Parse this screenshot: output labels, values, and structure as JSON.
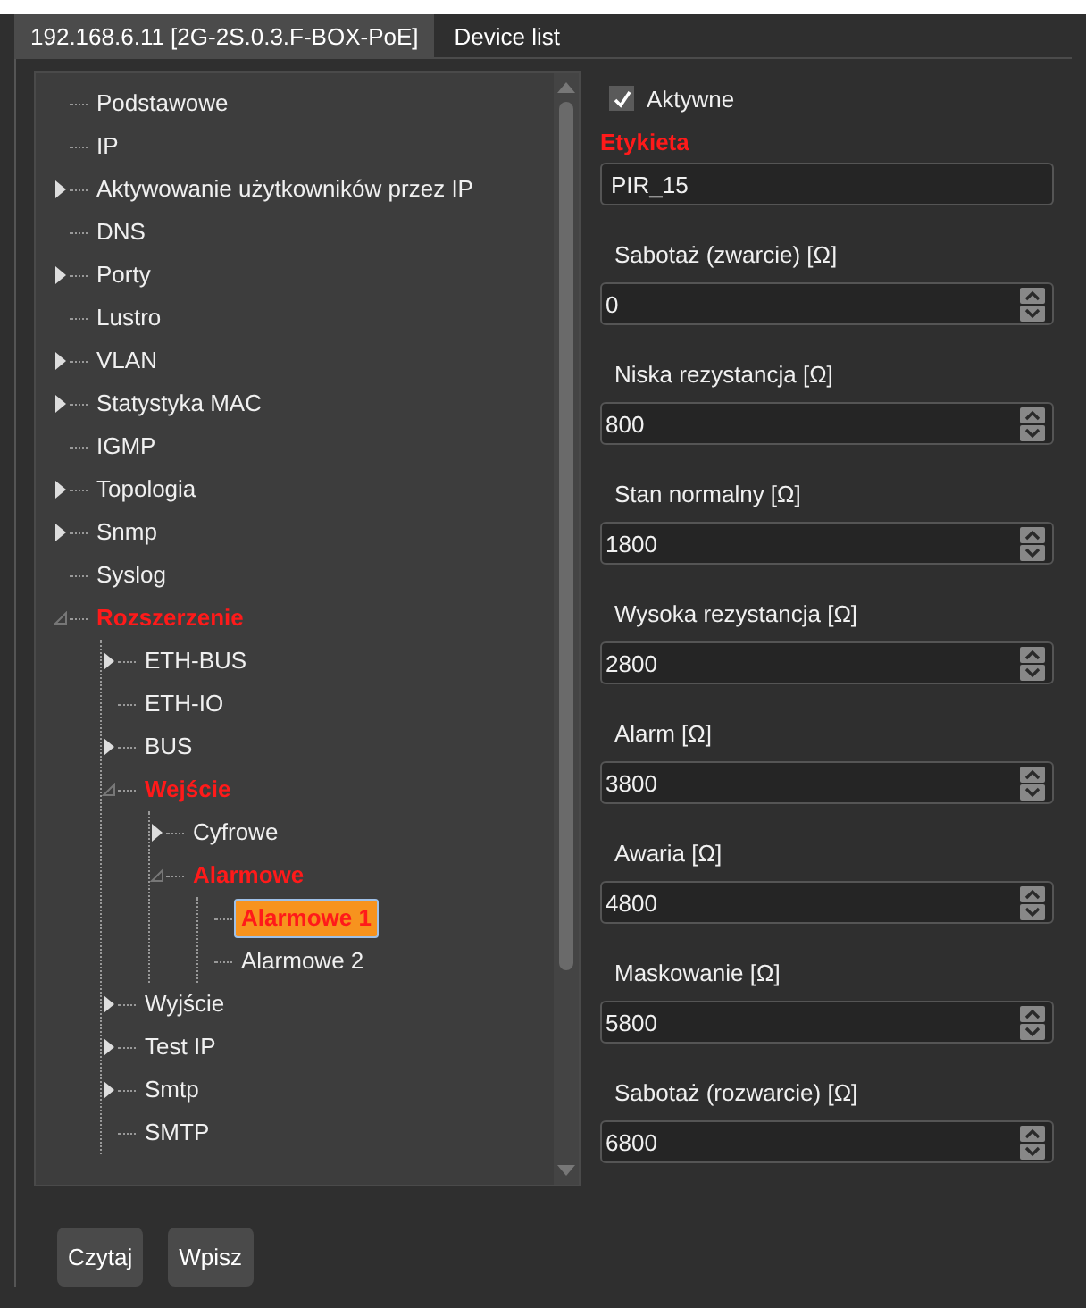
{
  "tabs": [
    {
      "label": "192.168.6.11 [2G-2S.0.3.F-BOX-PoE]",
      "selected": true
    },
    {
      "label": "Device list",
      "selected": false
    }
  ],
  "tree": [
    {
      "label": "Podstawowe",
      "kind": "leaf",
      "selected": false
    },
    {
      "label": "IP",
      "kind": "leaf",
      "selected": false
    },
    {
      "label": "Aktywowanie użytkowników przez IP",
      "kind": "folder",
      "expanded": false,
      "selected": false
    },
    {
      "label": "DNS",
      "kind": "leaf",
      "selected": false
    },
    {
      "label": "Porty",
      "kind": "folder",
      "expanded": false,
      "selected": false
    },
    {
      "label": "Lustro",
      "kind": "leaf",
      "selected": false
    },
    {
      "label": "VLAN",
      "kind": "folder",
      "expanded": false,
      "selected": false
    },
    {
      "label": "Statystyka MAC",
      "kind": "folder",
      "expanded": false,
      "selected": false
    },
    {
      "label": "IGMP",
      "kind": "leaf",
      "selected": false
    },
    {
      "label": "Topologia",
      "kind": "folder",
      "expanded": false,
      "selected": false
    },
    {
      "label": "Snmp",
      "kind": "folder",
      "expanded": false,
      "selected": false
    },
    {
      "label": "Syslog",
      "kind": "leaf",
      "selected": false
    },
    {
      "label": "Rozszerzenie",
      "kind": "folder",
      "expanded": true,
      "selected": false,
      "children": [
        {
          "label": "ETH-BUS",
          "kind": "folder",
          "expanded": false,
          "selected": false
        },
        {
          "label": "ETH-IO",
          "kind": "leaf",
          "selected": false
        },
        {
          "label": "BUS",
          "kind": "folder",
          "expanded": false,
          "selected": false
        },
        {
          "label": "Wejście",
          "kind": "folder",
          "expanded": true,
          "selected": false,
          "children": [
            {
              "label": "Cyfrowe",
              "kind": "folder",
              "expanded": false,
              "selected": false
            },
            {
              "label": "Alarmowe",
              "kind": "folder",
              "expanded": true,
              "selected": false,
              "children": [
                {
                  "label": "Alarmowe 1",
                  "kind": "leaf",
                  "selected": true
                },
                {
                  "label": "Alarmowe 2",
                  "kind": "leaf",
                  "selected": false
                }
              ]
            }
          ]
        },
        {
          "label": "Wyjście",
          "kind": "folder",
          "expanded": false,
          "selected": false
        },
        {
          "label": "Test IP",
          "kind": "folder",
          "expanded": false,
          "selected": false
        },
        {
          "label": "Smtp",
          "kind": "folder",
          "expanded": false,
          "selected": false
        },
        {
          "label": "SMTP",
          "kind": "leaf",
          "selected": false
        }
      ]
    }
  ],
  "buttons": [
    "Czytaj",
    "Wpisz"
  ],
  "active": {
    "label": "Aktywne",
    "checked": true
  },
  "fields": [
    {
      "label": "Etykieta",
      "kind": "text",
      "highlighted": true,
      "value": "PIR_15"
    },
    {
      "label": "Sabotaż (zwarcie) [Ω]",
      "kind": "number",
      "highlighted": false,
      "value": "0"
    },
    {
      "label": "Niska rezystancja [Ω]",
      "kind": "number",
      "highlighted": false,
      "value": "800"
    },
    {
      "label": "Stan normalny [Ω]",
      "kind": "number",
      "highlighted": false,
      "value": "1800"
    },
    {
      "label": "Wysoka rezystancja [Ω]",
      "kind": "number",
      "highlighted": false,
      "value": "2800"
    },
    {
      "label": "Alarm [Ω]",
      "kind": "number",
      "highlighted": false,
      "value": "3800"
    },
    {
      "label": "Awaria [Ω]",
      "kind": "number",
      "highlighted": false,
      "value": "4800"
    },
    {
      "label": "Maskowanie [Ω]",
      "kind": "number",
      "highlighted": false,
      "value": "5800"
    },
    {
      "label": "Sabotaż (rozwarcie) [Ω]",
      "kind": "number",
      "highlighted": false,
      "value": "6800"
    }
  ]
}
